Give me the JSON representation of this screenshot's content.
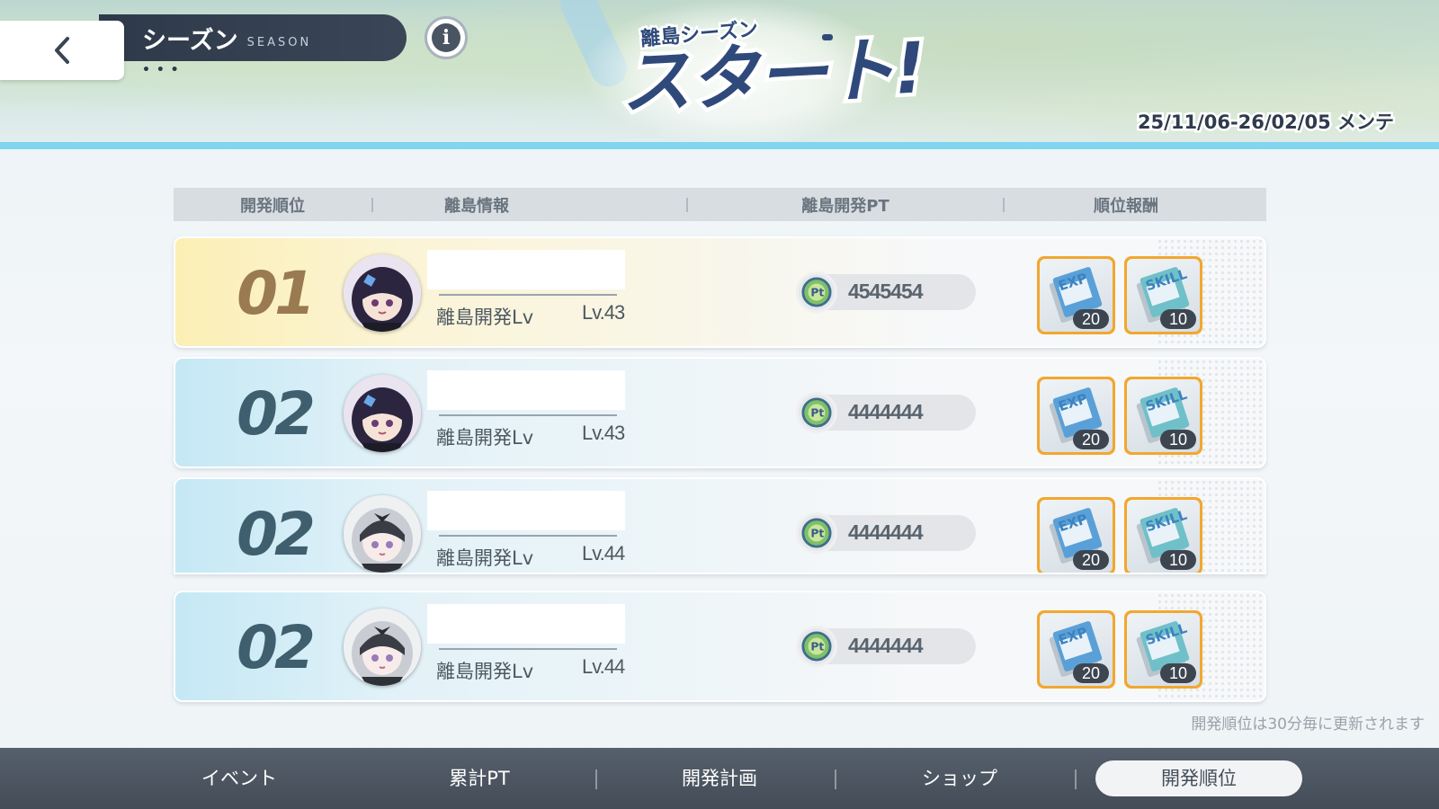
{
  "header": {
    "title": "シーズン",
    "subtitle": "SEASON",
    "dots": "• • •",
    "logo_small": "離島シーズン",
    "logo_big": "スタート!",
    "date_range": "25/11/06-26/02/05 メンテ"
  },
  "table": {
    "columns": [
      "開発順位",
      "離島情報",
      "離島開発PT",
      "順位報酬"
    ],
    "rows": [
      {
        "rank": "01",
        "level_label": "離島開発Lv",
        "level": "Lv.43",
        "pt": "4545454",
        "avatar": "dark-hair-girl-avatar",
        "rewards": [
          {
            "item": "exp-book-icon",
            "label": "EXP",
            "qty": "20"
          },
          {
            "item": "skill-book-icon",
            "label": "SKILL",
            "qty": "10"
          }
        ]
      },
      {
        "rank": "02",
        "level_label": "離島開発Lv",
        "level": "Lv.43",
        "pt": "4444444",
        "avatar": "dark-hair-girl-avatar",
        "rewards": [
          {
            "item": "exp-book-icon",
            "label": "EXP",
            "qty": "20"
          },
          {
            "item": "skill-book-icon",
            "label": "SKILL",
            "qty": "10"
          }
        ]
      },
      {
        "rank": "02",
        "level_label": "離島開発Lv",
        "level": "Lv.44",
        "pt": "4444444",
        "avatar": "silver-hair-girl-avatar",
        "rewards": [
          {
            "item": "exp-book-icon",
            "label": "EXP",
            "qty": "20"
          },
          {
            "item": "skill-book-icon",
            "label": "SKILL",
            "qty": "10"
          }
        ]
      },
      {
        "rank": "02",
        "level_label": "離島開発Lv",
        "level": "Lv.44",
        "pt": "4444444",
        "avatar": "silver-hair-girl-avatar",
        "rewards": [
          {
            "item": "exp-book-icon",
            "label": "EXP",
            "qty": "20"
          },
          {
            "item": "skill-book-icon",
            "label": "SKILL",
            "qty": "10"
          }
        ]
      }
    ]
  },
  "notice": "開発順位は30分毎に更新されます",
  "tabs": [
    {
      "label": "イベント",
      "active": false
    },
    {
      "label": "累計PT",
      "active": false
    },
    {
      "label": "開発計画",
      "active": false
    },
    {
      "label": "ショップ",
      "active": false
    },
    {
      "label": "開発順位",
      "active": true
    }
  ],
  "colors": {
    "accent_line": "#7fd6ee",
    "reward_border": "#f2a72f",
    "first_row_tint": "#fbefb5",
    "row_tint": "#c5e8f5",
    "tabbar": "#4b5560"
  }
}
